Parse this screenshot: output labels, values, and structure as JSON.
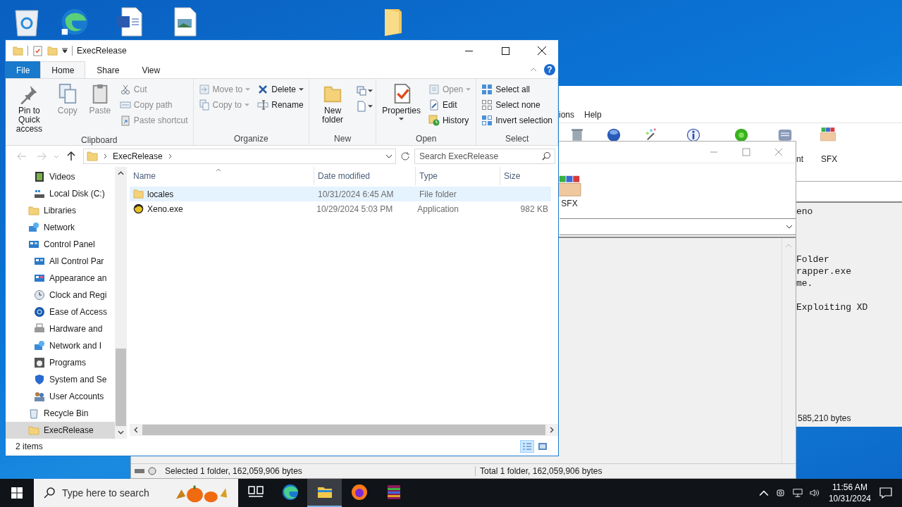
{
  "explorer": {
    "title": "ExecRelease",
    "tabs": [
      {
        "label": "File",
        "kind": "file",
        "selected": false
      },
      {
        "label": "Home",
        "kind": "tab",
        "selected": true
      },
      {
        "label": "Share",
        "kind": "tab",
        "selected": false
      },
      {
        "label": "View",
        "kind": "tab",
        "selected": false
      }
    ],
    "help": "?",
    "ribbon": [
      {
        "label": "Clipboard",
        "columns": [
          [
            {
              "label": "Pin to Quick access",
              "kind": "large",
              "disabled": false,
              "dropdown": false
            }
          ],
          [
            {
              "label": "Copy",
              "kind": "large",
              "disabled": true,
              "dropdown": false
            }
          ],
          [
            {
              "label": "Paste",
              "kind": "large",
              "disabled": true,
              "dropdown": false
            }
          ],
          [
            {
              "label": "Cut",
              "kind": "small",
              "disabled": true,
              "dropdown": false
            },
            {
              "label": "Copy path",
              "kind": "small",
              "disabled": true,
              "dropdown": false
            },
            {
              "label": "Paste shortcut",
              "kind": "small",
              "disabled": true,
              "dropdown": false
            }
          ]
        ]
      },
      {
        "label": "Organize",
        "columns": [
          [
            {
              "label": "Move to",
              "kind": "small",
              "disabled": true,
              "dropdown": true
            },
            {
              "label": "Copy to",
              "kind": "small",
              "disabled": true,
              "dropdown": true
            }
          ],
          [
            {
              "label": "Delete",
              "kind": "small",
              "disabled": false,
              "dropdown": true
            },
            {
              "label": "Rename",
              "kind": "small",
              "disabled": false,
              "dropdown": false
            }
          ]
        ]
      },
      {
        "label": "New",
        "columns": [
          [
            {
              "label": "New folder",
              "kind": "large",
              "disabled": false,
              "dropdown": false
            }
          ],
          [
            {
              "kind": "icon",
              "disabled": false,
              "dropdown": true
            },
            {
              "kind": "icon",
              "disabled": false,
              "dropdown": true
            }
          ]
        ]
      },
      {
        "label": "Open",
        "columns": [
          [
            {
              "label": "Properties",
              "kind": "large",
              "disabled": false,
              "dropdown": true
            }
          ],
          [
            {
              "label": "Open",
              "kind": "small",
              "disabled": true,
              "dropdown": true
            },
            {
              "label": "Edit",
              "kind": "small",
              "disabled": false,
              "dropdown": false
            },
            {
              "label": "History",
              "kind": "small",
              "disabled": false,
              "dropdown": false
            }
          ]
        ]
      },
      {
        "label": "Select",
        "columns": [
          [
            {
              "label": "Select all",
              "kind": "small",
              "disabled": false,
              "dropdown": false
            },
            {
              "label": "Select none",
              "kind": "small",
              "disabled": false,
              "dropdown": false
            },
            {
              "label": "Invert selection",
              "kind": "small",
              "disabled": false,
              "dropdown": false
            }
          ]
        ]
      }
    ],
    "address": [
      "ExecRelease"
    ],
    "search": {
      "placeholder": "Search ExecRelease"
    },
    "nav": [
      {
        "children": [
          {
            "label": "Videos",
            "selected": false
          },
          {
            "label": "Local Disk (C:)",
            "selected": false
          }
        ]
      },
      {
        "label": "Libraries",
        "selected": false
      },
      {
        "label": "Network",
        "selected": false
      },
      {
        "label": "Control Panel",
        "selected": false,
        "children": [
          {
            "label": "All Control Par",
            "selected": false
          },
          {
            "label": "Appearance an",
            "selected": false
          },
          {
            "label": "Clock and Regi",
            "selected": false
          },
          {
            "label": "Ease of Access",
            "selected": false
          },
          {
            "label": "Hardware and",
            "selected": false
          },
          {
            "label": "Network and I",
            "selected": false
          },
          {
            "label": "Programs",
            "selected": false
          },
          {
            "label": "System and Se",
            "selected": false
          },
          {
            "label": "User Accounts",
            "selected": false
          }
        ]
      },
      {
        "label": "Recycle Bin",
        "selected": false
      },
      {
        "label": "ExecRelease",
        "selected": true
      }
    ],
    "columns": [
      "Name",
      "Date modified",
      "Type",
      "Size"
    ],
    "rows": [
      {
        "kind": "folder",
        "name": "locales",
        "date": "10/31/2024 6:45 AM",
        "type": "File folder",
        "highlighted": true
      },
      {
        "kind": "application",
        "name": "Xeno.exe",
        "date": "10/29/2024 5:03 PM",
        "type": "Application",
        "size": "982 KB",
        "highlighted": false
      }
    ],
    "status": "2 items",
    "views": [
      {
        "kind": "details",
        "selected": true
      },
      {
        "kind": "large-icons",
        "selected": false
      }
    ]
  },
  "winrar_main": {
    "menu": [
      "ions",
      "Help"
    ],
    "toolbar_labels": [
      "nt",
      "SFX"
    ],
    "log": [
      [
        "eno"
      ],
      [
        "Folder",
        "rapper.exe",
        "me."
      ],
      [
        "Exploiting XD"
      ]
    ],
    "status": "585,210 bytes"
  },
  "winrar_window": {
    "toolbar_label": "SFX",
    "status_selected": "Selected 1 folder, 162,059,906 bytes",
    "status_total": "Total 1 folder, 162,059,906 bytes"
  },
  "taskbar": {
    "search": {
      "placeholder": "Type here to search"
    },
    "apps": [
      {
        "selected": false
      },
      {
        "selected": false
      },
      {
        "selected": true
      },
      {
        "selected": false
      },
      {
        "selected": false
      }
    ],
    "time": "11:56 AM",
    "date": "10/31/2024"
  }
}
